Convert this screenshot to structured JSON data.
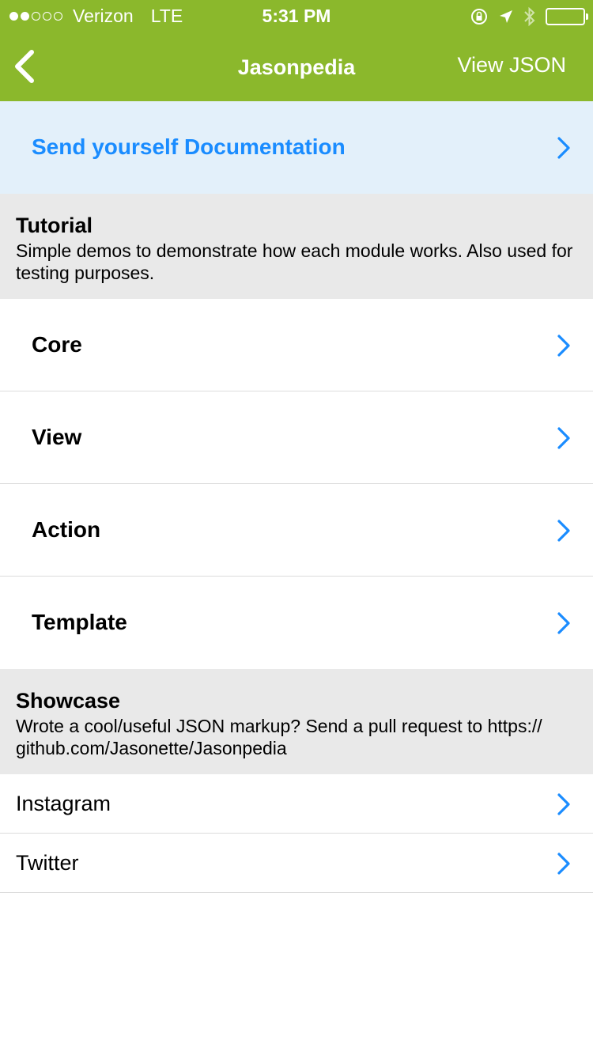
{
  "status_bar": {
    "signal": "●●○○○",
    "carrier": "Verizon",
    "network": "LTE",
    "time": "5:31 PM",
    "icons": [
      "rotation-lock-icon",
      "location-arrow-icon",
      "bluetooth-icon",
      "battery-icon"
    ]
  },
  "nav": {
    "back_icon": "chevron-left-icon",
    "title": "Jasonpedia",
    "action_label": "View JSON"
  },
  "promo": {
    "label": "Send yourself Documentation"
  },
  "sections": [
    {
      "title": "Tutorial",
      "description": "Simple demos to demonstrate how each module works. Also used for testing purposes.",
      "items": [
        {
          "label": "Core"
        },
        {
          "label": "View"
        },
        {
          "label": "Action"
        },
        {
          "label": "Template"
        }
      ]
    },
    {
      "title": "Showcase",
      "description": "Wrote a cool/useful JSON markup? Send a pull request to https:// github.com/Jasonette/Jasonpedia",
      "items": [
        {
          "label": "Instagram"
        },
        {
          "label": "Twitter"
        }
      ]
    }
  ],
  "colors": {
    "header_green": "#8bb82c",
    "accent_blue": "#1a8cff",
    "promo_bg": "#e3f0fa",
    "section_bg": "#e9e9e9"
  }
}
